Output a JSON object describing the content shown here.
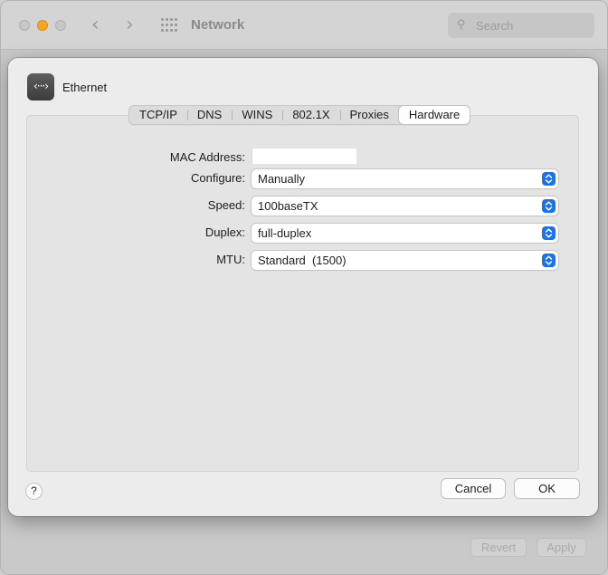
{
  "window": {
    "title": "Network",
    "search_placeholder": "Search",
    "back_icon": "chevron-left-icon",
    "forward_icon": "chevron-right-icon",
    "grid_icon": "show-all-grid-icon",
    "revert_label": "Revert",
    "apply_label": "Apply"
  },
  "sheet": {
    "service_name": "Ethernet",
    "service_icon_glyph": "‹···›",
    "tabs": [
      {
        "label": "TCP/IP",
        "active": false
      },
      {
        "label": "DNS",
        "active": false
      },
      {
        "label": "WINS",
        "active": false
      },
      {
        "label": "802.1X",
        "active": false
      },
      {
        "label": "Proxies",
        "active": false
      },
      {
        "label": "Hardware",
        "active": true
      }
    ],
    "fields": {
      "mac_label": "MAC Address:",
      "mac_value": "",
      "configure_label": "Configure:",
      "configure_value": "Manually",
      "speed_label": "Speed:",
      "speed_value": "100baseTX",
      "duplex_label": "Duplex:",
      "duplex_value": "full-duplex",
      "mtu_label": "MTU:",
      "mtu_value": "Standard  (1500)"
    },
    "help_label": "?",
    "cancel_label": "Cancel",
    "ok_label": "OK"
  },
  "colors": {
    "accent": "#1a73e8",
    "minimize": "#f5a623"
  }
}
